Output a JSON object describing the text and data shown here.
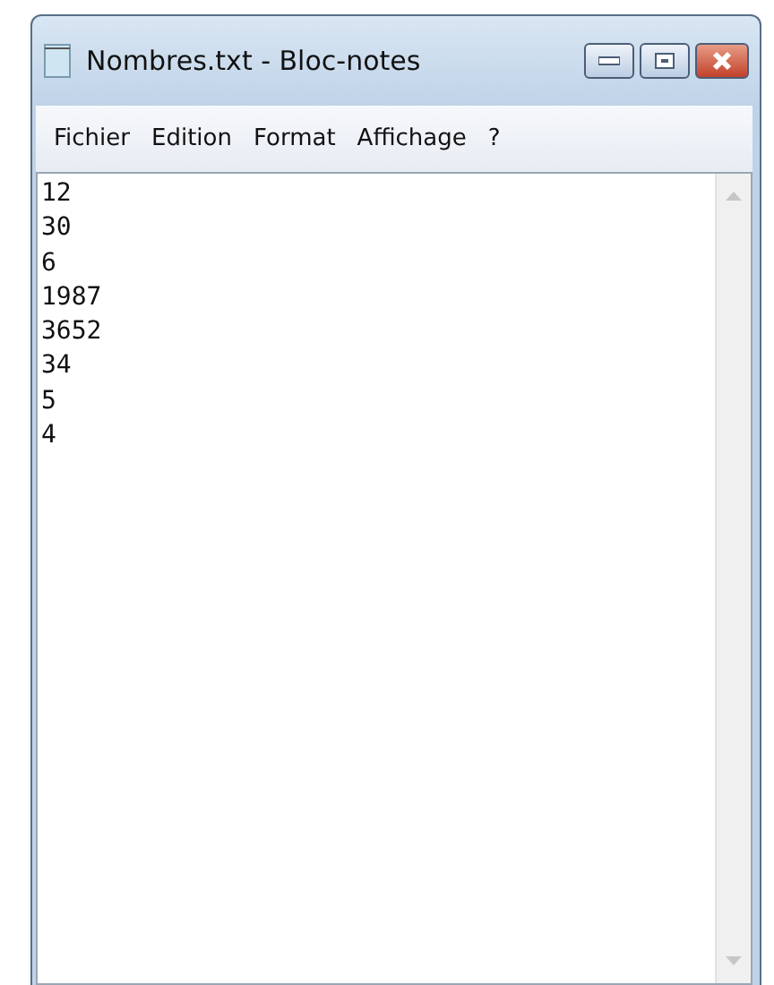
{
  "window": {
    "title": "Nombres.txt - Bloc-notes"
  },
  "menu": [
    "Fichier",
    "Edition",
    "Format",
    "Affichage",
    "?"
  ],
  "document": {
    "lines": [
      "12",
      "30",
      "6",
      "1987",
      "3652",
      "34",
      "5",
      "4"
    ]
  }
}
